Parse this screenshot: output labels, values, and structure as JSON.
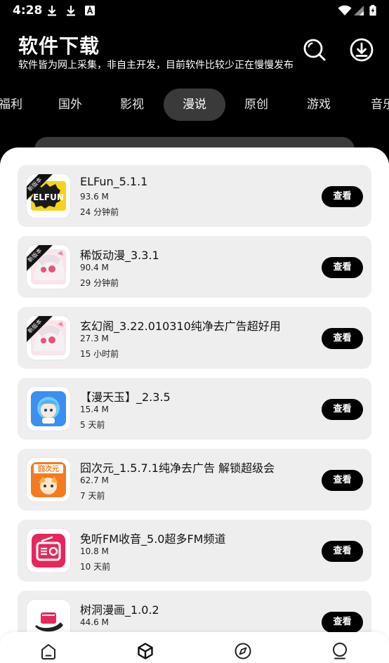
{
  "status_bar": {
    "time": "4:28"
  },
  "header": {
    "title": "软件下载",
    "subtitle": "软件皆为网上采集，非自主开发，目前软件比较少正在慢慢发布"
  },
  "tabs": [
    {
      "label": "福利"
    },
    {
      "label": "国外"
    },
    {
      "label": "影视"
    },
    {
      "label": "漫说",
      "active": true
    },
    {
      "label": "原创"
    },
    {
      "label": "游戏"
    },
    {
      "label": "音乐"
    }
  ],
  "apps": [
    {
      "name": "ELFun_5.1.1",
      "size": "93.6 M",
      "time": "24 分钟前",
      "button": "查看",
      "badge": "新版本",
      "icon": "elfun-app-icon"
    },
    {
      "name": "稀饭动漫_3.3.1",
      "size": "90.4 M",
      "time": "29 分钟前",
      "button": "查看",
      "badge": "新版本",
      "icon": "anime-girl-app-icon"
    },
    {
      "name": "玄幻阁_3.22.010310纯净去广告超好用",
      "size": "27.3 M",
      "time": "15 小时前",
      "button": "查看",
      "badge": "新版本",
      "icon": "anime-girl-app-icon"
    },
    {
      "name": "【漫天玉】_2.3.5",
      "size": "15.4 M",
      "time": "5 天前",
      "button": "查看",
      "icon": "blue-hair-chibi-app-icon"
    },
    {
      "name": "囧次元_1.5.7.1纯净去广告 解锁超级会",
      "size": "62.7 M",
      "time": "7 天前",
      "button": "查看",
      "icon": "jiongciyuan-app-icon",
      "icon_text": "囧次元"
    },
    {
      "name": "免听FM收音_5.0超多FM频道",
      "size": "10.8 M",
      "time": "10 天前",
      "button": "查看",
      "icon": "radio-app-icon"
    },
    {
      "name": "树洞漫画_1.0.2",
      "size": "44.6 M",
      "time": "",
      "button": "查看",
      "icon": "treehole-app-icon"
    }
  ],
  "bottom_nav": [
    {
      "icon": "home-icon"
    },
    {
      "icon": "cube-icon",
      "active": true
    },
    {
      "icon": "compass-icon"
    },
    {
      "icon": "profile-icon"
    }
  ],
  "colors": {
    "background": "#000000",
    "card": "#eeeeee",
    "button": "#000000",
    "sheet": "#ffffff"
  }
}
